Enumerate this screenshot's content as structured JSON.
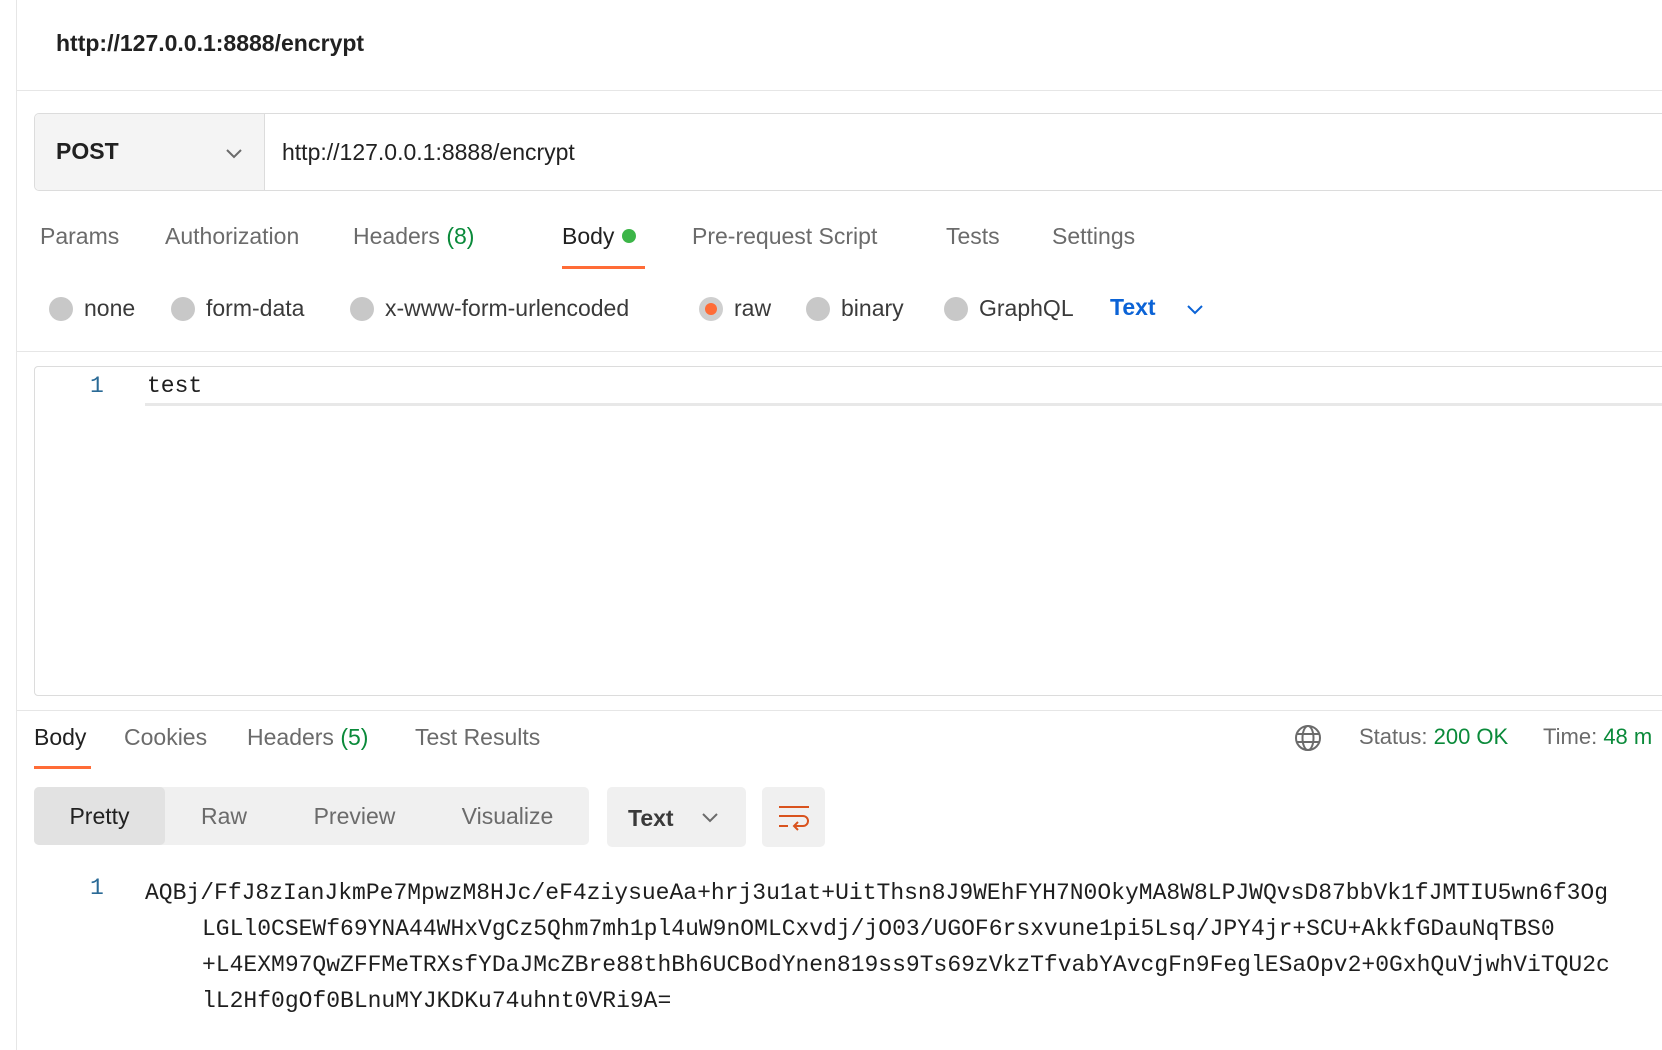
{
  "window": {
    "title": "http://127.0.0.1:8888/encrypt"
  },
  "request": {
    "method": "POST",
    "url": "http://127.0.0.1:8888/encrypt",
    "tabs": {
      "params": "Params",
      "authorization": "Authorization",
      "headers": "Headers",
      "headers_count": "(8)",
      "body": "Body",
      "pre_request": "Pre-request Script",
      "tests": "Tests",
      "settings": "Settings"
    },
    "body_types": {
      "none": "none",
      "form_data": "form-data",
      "urlencoded": "x-www-form-urlencoded",
      "raw": "raw",
      "binary": "binary",
      "graphql": "GraphQL"
    },
    "raw_format": "Text",
    "editor": {
      "line_number": "1",
      "content": "test"
    }
  },
  "response": {
    "tabs": {
      "body": "Body",
      "cookies": "Cookies",
      "headers": "Headers",
      "headers_count": "(5)",
      "test_results": "Test Results"
    },
    "status_label": "Status:",
    "status_value": "200 OK",
    "time_label": "Time:",
    "time_value": "48 m",
    "view_modes": {
      "pretty": "Pretty",
      "raw": "Raw",
      "preview": "Preview",
      "visualize": "Visualize"
    },
    "format": "Text",
    "line_number": "1",
    "content_lines": [
      "AQBj/FfJ8zIanJkmPe7MpwzM8HJc/eF4ziysueAa+hrj3u1at+UitThsn8J9WEhFYH7N0OkyMA8W8LPJWQvsD87bbVk1fJMTIU5wn6f3Og",
      "LGLl0CSEWf69YNA44WHxVgCz5Qhm7mh1pl4uW9nOMLCxvdj/jO03/UGOF6rsxvune1pi5Lsq/JPY4jr+SCU+AkkfGDauNqTBS0",
      "+L4EXM97QwZFFMeTRXsfYDaJMcZBre88thBh6UCBodYnen819ss9Ts69zVkzTfvabYAvcgFn9FeglESaOpv2+0GxhQuVjwhViTQU2c",
      "lL2Hf0gOf0BLnuMYJKDKu74uhnt0VRi9A="
    ]
  },
  "colors": {
    "accent": "#ff6c37",
    "success": "#0a8a3a",
    "link": "#0b63d6",
    "body_indicator": "#3cb548"
  },
  "icons": {
    "method_dropdown": "chevron-down-icon",
    "format_dropdown": "chevron-down-icon",
    "network": "globe-icon",
    "wrap": "wrap-lines-icon"
  }
}
